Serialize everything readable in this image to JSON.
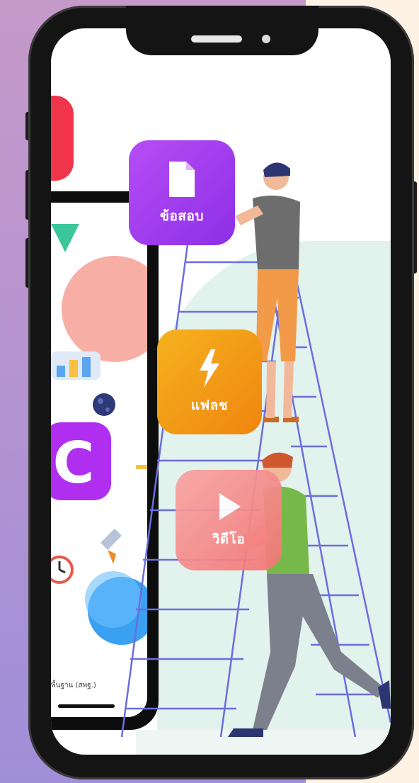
{
  "apps": {
    "document": {
      "label": "ข้อสอบ",
      "icon": "document-icon",
      "color": "#a33ff0"
    },
    "flash": {
      "label": "แฟลช",
      "icon": "lightning-icon",
      "color": "#f39a12"
    },
    "video": {
      "label": "วิดีโอ",
      "icon": "play-icon",
      "color": "#f47a7a"
    }
  },
  "inner_phone": {
    "caption": "พื้นฐาน (สพฐ.)"
  },
  "colors": {
    "background_left": "#b894cf",
    "background_right": "#fdf2e3",
    "mint": "#e2f2ec",
    "ladder": "#6a6ee0"
  }
}
